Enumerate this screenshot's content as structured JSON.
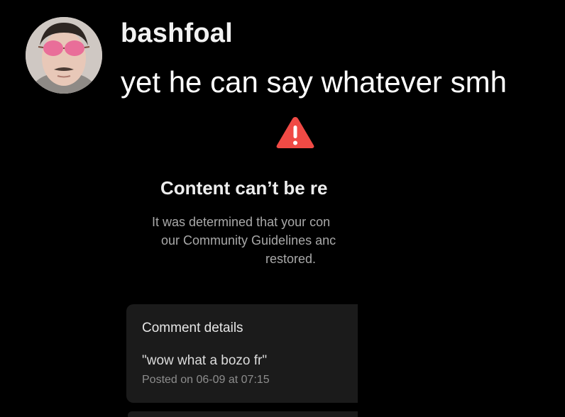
{
  "post": {
    "username": "bashfoal",
    "caption": "yet he can say whatever smh",
    "avatar_icon": "profile-photo-pink-sunglasses"
  },
  "embedded_screenshot": {
    "icon": "warning-triangle-icon",
    "warning_color": "#f04a45",
    "title": "Content can’t be re",
    "message_lines": [
      "It was determined that your con",
      "our Community Guidelines anc",
      "restored."
    ],
    "comment_details": {
      "heading": "Comment details",
      "comment": "\"wow what a bozo fr\"",
      "posted": "Posted on 06-09 at 07:15"
    }
  }
}
